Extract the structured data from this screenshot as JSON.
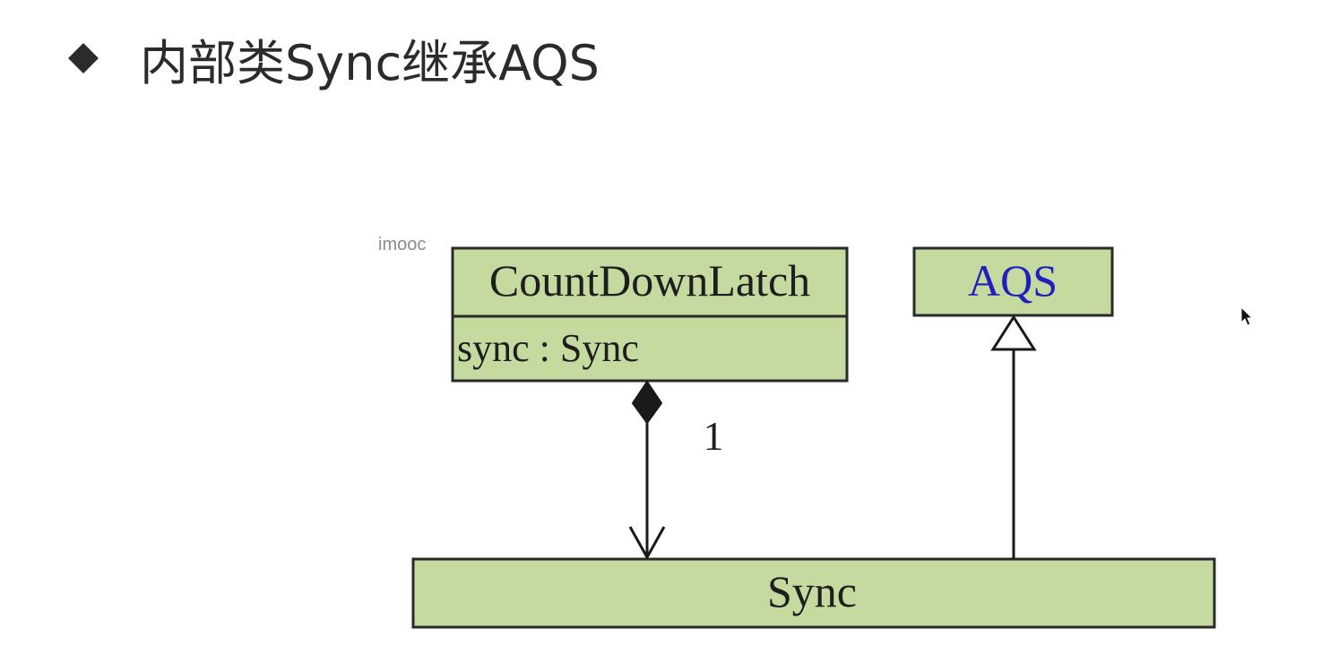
{
  "header": {
    "bullet_icon": "diamond-bullet-icon",
    "title": "内部类Sync继承AQS"
  },
  "watermark": "imooc",
  "diagram": {
    "classes": {
      "countdownlatch": {
        "name": "CountDownLatch",
        "attribute": "sync : Sync"
      },
      "aqs": {
        "name": "AQS"
      },
      "sync": {
        "name": "Sync"
      }
    },
    "relations": {
      "composition": {
        "from": "CountDownLatch",
        "to": "Sync",
        "multiplicity": "1"
      },
      "inheritance": {
        "from": "Sync",
        "to": "AQS"
      }
    },
    "colors": {
      "box_fill": "#c4da9e",
      "border": "#2a2a2a",
      "aqs_text": "#1f1fbf"
    }
  }
}
